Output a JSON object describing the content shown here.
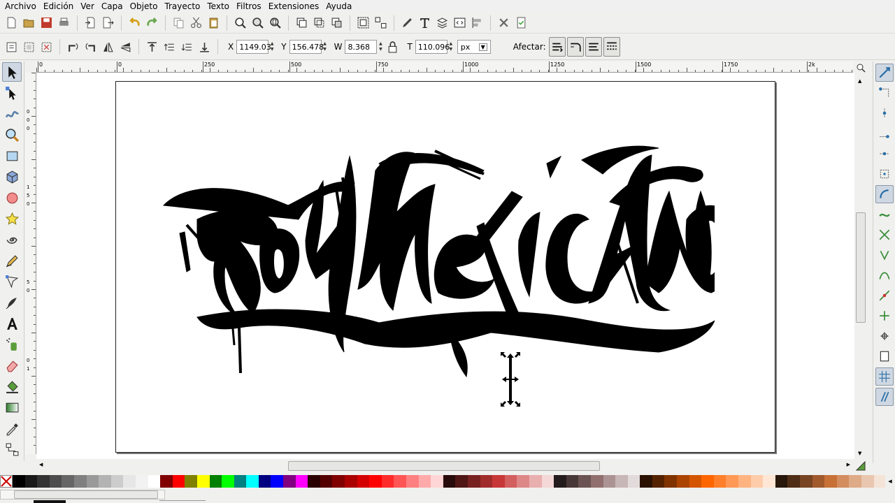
{
  "menu": [
    "Archivo",
    "Edición",
    "Ver",
    "Capa",
    "Objeto",
    "Trayecto",
    "Texto",
    "Filtros",
    "Extensiones",
    "Ayuda"
  ],
  "controls": {
    "x_label": "X",
    "x_value": "1149.03",
    "y_label": "Y",
    "y_value": "156.478",
    "w_label": "W",
    "w_value": "8.368",
    "h_label": "T",
    "h_value": "110.096",
    "unit": "px",
    "affect_label": "Afectar:"
  },
  "rulers": {
    "h_ticks": [
      "0",
      "0",
      "250",
      "500",
      "750",
      "1000",
      "1250",
      "1500",
      "1750",
      "2k"
    ],
    "v_ticks": [
      "0",
      "0",
      "0",
      "1",
      "5",
      "0",
      "5",
      "0",
      "0",
      "1"
    ]
  },
  "artwork": {
    "description_icon": "graffiti-lettering-artwork",
    "text": "Soy Mexicano"
  },
  "palette": [
    "#000000",
    "#1a1a1a",
    "#333333",
    "#4d4d4d",
    "#666666",
    "#808080",
    "#999999",
    "#b3b3b3",
    "#cccccc",
    "#e6e6e6",
    "#f2f2f2",
    "#ffffff",
    "#800000",
    "#ff0000",
    "#808000",
    "#ffff00",
    "#008000",
    "#00ff00",
    "#008080",
    "#00ffff",
    "#000080",
    "#0000ff",
    "#800080",
    "#ff00ff",
    "#2b0000",
    "#550000",
    "#800000",
    "#aa0000",
    "#d40000",
    "#ff0000",
    "#ff2a2a",
    "#ff5555",
    "#ff8080",
    "#ffaaaa",
    "#ffd5d5",
    "#280b0b",
    "#501616",
    "#782121",
    "#a02c2c",
    "#c83737",
    "#d35f5f",
    "#de8787",
    "#e9afaf",
    "#f4d7d7",
    "#241c1c",
    "#483737",
    "#6c5353",
    "#916f6f",
    "#ac9393",
    "#c8b7b7",
    "#e3dbdb",
    "#2b1100",
    "#552200",
    "#803300",
    "#aa4400",
    "#d45500",
    "#ff6600",
    "#ff7f2a",
    "#ff9955",
    "#ffb380",
    "#ffccaa",
    "#ffe6d5",
    "#28170b",
    "#502d16",
    "#784421",
    "#a05a2c",
    "#c87137",
    "#d38d5f",
    "#deaa87",
    "#e9c6af",
    "#f4e3d7"
  ]
}
